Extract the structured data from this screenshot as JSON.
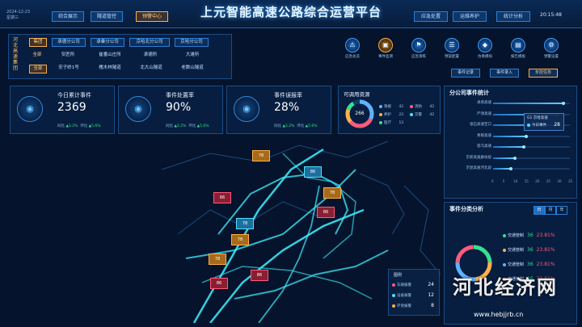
{
  "header": {
    "title": "上元智能高速公路综合运营平台",
    "date": "2024-12-23",
    "weekday": "星期三",
    "time": "20:15:48",
    "nav_left": [
      "综合展示",
      "隧道管控",
      "预警中心"
    ],
    "nav_right": [
      "应急处置",
      "运维养护",
      "统计分析"
    ],
    "active_nav": "预警中心"
  },
  "org": {
    "title": "河北高速集团",
    "row1": [
      "集团",
      "承德分公司",
      "承秦分公司",
      "京哈北分公司",
      "京哈分公司"
    ],
    "row2": [
      "全部",
      "安匠所",
      "崔番山庄所",
      "承德所",
      "大滩所"
    ],
    "row3": [
      "全部",
      "安子岭1号",
      "槐木林隧道",
      "北大山隧道",
      "老数山隧道"
    ]
  },
  "toolbar": {
    "tools": [
      {
        "label": "应急总览",
        "icon": "alarm-icon"
      },
      {
        "label": "事件监测",
        "icon": "monitor-icon"
      },
      {
        "label": "应急演练",
        "icon": "drill-icon"
      },
      {
        "label": "预案配置",
        "icon": "config-icon"
      },
      {
        "label": "仿真模拟",
        "icon": "cube-icon"
      },
      {
        "label": "报告模板",
        "icon": "report-icon"
      },
      {
        "label": "预警设置",
        "icon": "setting-icon"
      }
    ],
    "buttons": [
      "事件记录",
      "事件录入",
      "年控任务"
    ]
  },
  "stats": [
    {
      "name": "今日累计事件",
      "value": "2369",
      "tongbi": "同比",
      "tongbi_val": "3.2%",
      "huanbi": "环比",
      "huanbi_val": "5.6%"
    },
    {
      "name": "事件处置率",
      "value": "90%",
      "tongbi": "同比",
      "tongbi_val": "3.2%",
      "huanbi": "环比",
      "huanbi_val": "5.6%"
    },
    {
      "name": "事件误报率",
      "value": "28%",
      "tongbi": "同比",
      "tongbi_val": "3.2%",
      "huanbi": "环比",
      "huanbi_val": "5.6%"
    }
  ],
  "resources": {
    "title": "可调用资源",
    "total": "266",
    "items": [
      {
        "name": "救援",
        "value": "42",
        "color": "#5fb2ff"
      },
      {
        "name": "消防",
        "value": "42",
        "color": "#ff5a7a"
      },
      {
        "name": "养护",
        "value": "23",
        "color": "#ffb04a"
      },
      {
        "name": "交警",
        "value": "42",
        "color": "#4fe0ff"
      },
      {
        "name": "医疗",
        "value": "13",
        "color": "#37e08e"
      }
    ]
  },
  "map": {
    "markers": [
      {
        "label": "78",
        "kind": "warn"
      },
      {
        "label": "86",
        "kind": "cam"
      },
      {
        "label": "78",
        "kind": "warn"
      },
      {
        "label": "66",
        "kind": "car"
      },
      {
        "label": "86",
        "kind": "car"
      },
      {
        "label": "78",
        "kind": "cam"
      },
      {
        "label": "78",
        "kind": "warn"
      },
      {
        "label": "86",
        "kind": "car"
      },
      {
        "label": "86",
        "kind": "car"
      },
      {
        "label": "78",
        "kind": "warn"
      }
    ],
    "legend": {
      "title": "图例",
      "items": [
        {
          "name": "车辆报警",
          "value": "24"
        },
        {
          "name": "设备报警",
          "value": "12"
        },
        {
          "name": "环境报警",
          "value": "8"
        }
      ]
    }
  },
  "segments": {
    "title": "分公司事件统计",
    "axis": [
      "0",
      "5",
      "10",
      "15",
      "20",
      "25",
      "30",
      "35"
    ],
    "tooltip": {
      "name": "G1 京哈高速",
      "series": "今日事件",
      "value": "28"
    }
  },
  "chart_data": {
    "type": "bar",
    "title": "分公司事件统计",
    "categories": [
      "承承高速",
      "严领高速",
      "张石高速空口",
      "青银高速",
      "容乌高速",
      "京新高速廊坊段",
      "京昆高速河北段"
    ],
    "values": [
      32,
      29,
      28,
      15,
      14,
      10,
      8
    ],
    "xlim": [
      0,
      35
    ]
  },
  "category": {
    "title": "事件分类分析",
    "tabs": [
      "日",
      "月",
      "年"
    ],
    "active_tab": "日",
    "items": [
      {
        "name": "交通管制",
        "count": "36",
        "percent": "23.81%"
      },
      {
        "name": "交通管制",
        "count": "36",
        "percent": "23.81%"
      },
      {
        "name": "交通管制",
        "count": "36",
        "percent": "23.81%"
      },
      {
        "name": "交通管制",
        "count": "36",
        "percent": "23.81%"
      }
    ]
  },
  "watermark": {
    "text": "河北经济网",
    "url": "www.hebjjrb.cn"
  }
}
